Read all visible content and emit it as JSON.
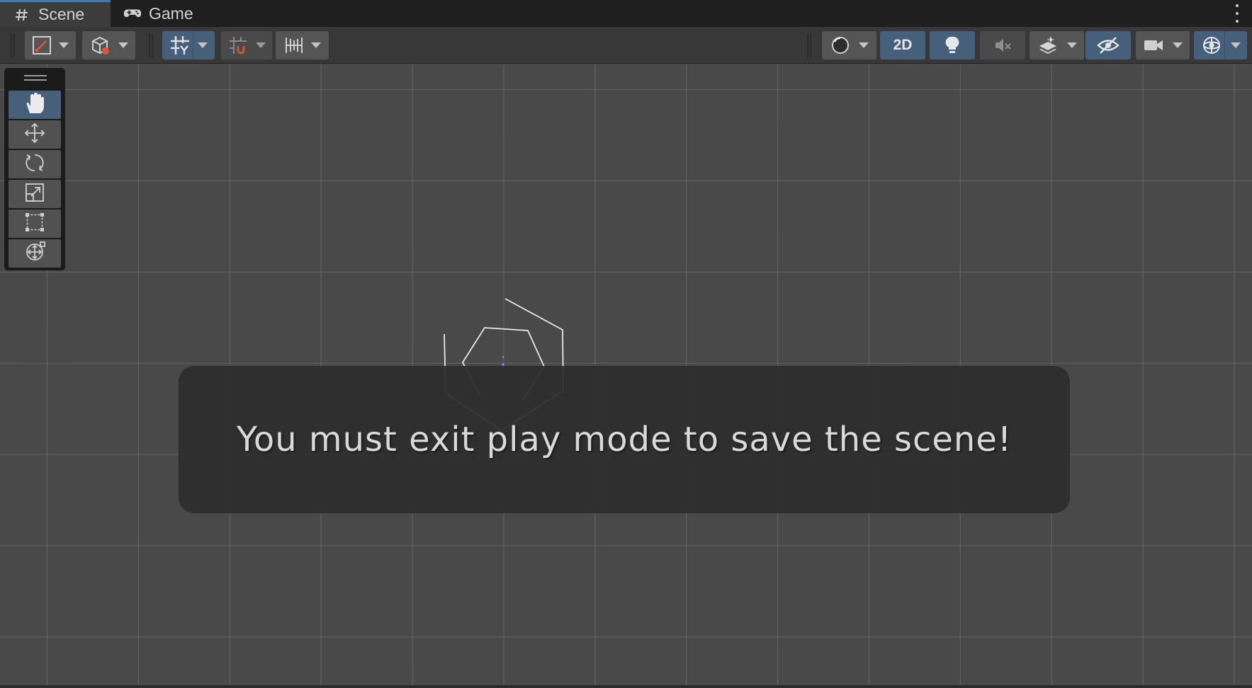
{
  "tabs": [
    {
      "label": "Scene",
      "icon": "grid-hash-icon",
      "active": true
    },
    {
      "label": "Game",
      "icon": "gamepad-icon",
      "active": false
    }
  ],
  "toolbar": {
    "left": [
      {
        "name": "draw-mode-dropdown",
        "icon": "draw-mode-icon"
      },
      {
        "name": "view-options-dropdown",
        "icon": "cube-icon"
      },
      {
        "name": "grid-snapping-dropdown",
        "icon": "grid-axis-icon",
        "active": true
      },
      {
        "name": "incremental-snap-dropdown",
        "icon": "snap-magnet-icon"
      },
      {
        "name": "grid-visibility-dropdown",
        "icon": "ruler-icon"
      }
    ],
    "right": [
      {
        "name": "shading-mode-dropdown",
        "icon": "sphere-icon"
      },
      {
        "name": "toggle-2d-button",
        "label": "2D",
        "active": true
      },
      {
        "name": "lighting-toggle",
        "icon": "lightbulb-icon",
        "active": true
      },
      {
        "name": "audio-toggle",
        "icon": "speaker-mute-icon"
      },
      {
        "name": "effects-dropdown",
        "icon": "effects-layers-icon"
      },
      {
        "name": "scene-visibility-toggle",
        "icon": "eye-hidden-icon",
        "active": true
      },
      {
        "name": "camera-dropdown",
        "icon": "camera-icon"
      },
      {
        "name": "gizmos-dropdown",
        "icon": "gizmo-globe-icon",
        "active": true
      }
    ],
    "accent": "#46607c"
  },
  "tools": [
    {
      "name": "hand-tool",
      "icon": "hand-icon",
      "active": true
    },
    {
      "name": "move-tool",
      "icon": "move-arrows-icon"
    },
    {
      "name": "rotate-tool",
      "icon": "rotate-icon"
    },
    {
      "name": "scale-tool",
      "icon": "scale-icon"
    },
    {
      "name": "rect-tool",
      "icon": "rect-transform-icon"
    },
    {
      "name": "transform-tool",
      "icon": "transform-icon"
    }
  ],
  "notification": {
    "message": "You must exit play mode to save the scene!"
  }
}
